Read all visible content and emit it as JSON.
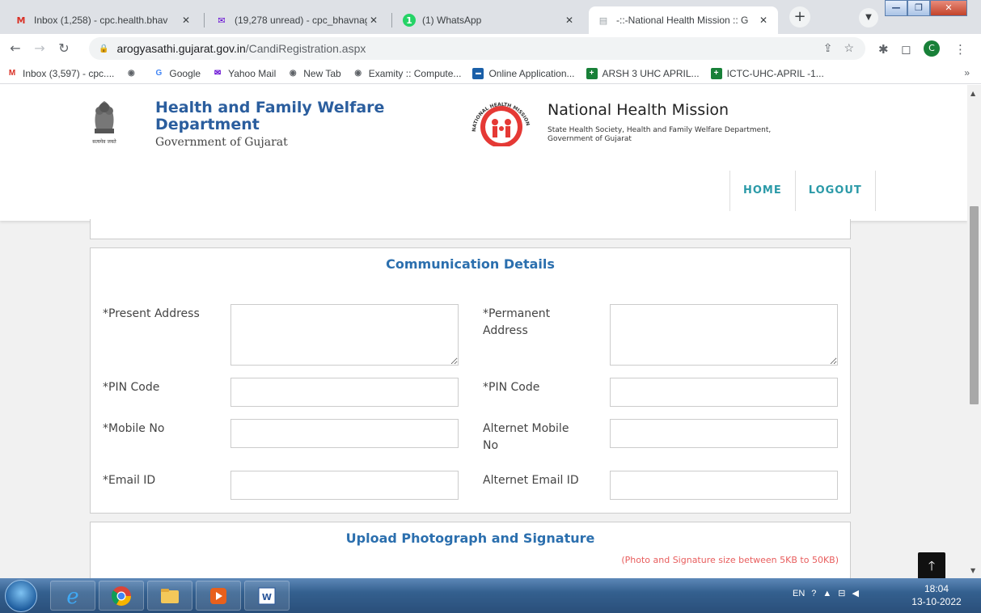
{
  "tabs": [
    {
      "title": "Inbox (1,258) - cpc.health.bhav",
      "icon": "gmail-icon"
    },
    {
      "title": "(19,278 unread) - cpc_bhavnag",
      "icon": "yahoo-mail-icon"
    },
    {
      "title": "(1) WhatsApp",
      "icon": "whatsapp-icon"
    },
    {
      "title": "-::-National Health Mission :: G",
      "icon": "page-icon",
      "active": true
    }
  ],
  "address": {
    "host": "arogyasathi.gujarat.gov.in",
    "path": "/CandiRegistration.aspx"
  },
  "profile_initial": "C",
  "bookmarks": [
    {
      "label": "Inbox (3,597) - cpc....",
      "icon": "gmail-icon"
    },
    {
      "label": "",
      "icon": "globe-icon"
    },
    {
      "label": "Google",
      "icon": "google-icon"
    },
    {
      "label": "Yahoo Mail",
      "icon": "yahoo-mail-icon"
    },
    {
      "label": "New Tab",
      "icon": "globe-icon"
    },
    {
      "label": "Examity :: Compute...",
      "icon": "globe-icon"
    },
    {
      "label": "Online Application...",
      "icon": "form-icon"
    },
    {
      "label": "ARSH 3 UHC APRIL...",
      "icon": "sheets-icon"
    },
    {
      "label": "ICTC-UHC-APRIL -1...",
      "icon": "sheets-icon"
    }
  ],
  "bookmarks_more": "»",
  "site": {
    "dept_title_line1": "Health and Family Welfare",
    "dept_title_line2": "Department",
    "dept_subtitle": "Government of Gujarat",
    "emblem_motto": "सत्यमेव जयते",
    "nhm_title": "National Health Mission",
    "nhm_sub_line1": "State Health Society, Health and Family Welfare Department,",
    "nhm_sub_line2": "Government of Gujarat",
    "nhm_logo_text": "NATIONAL HEALTH MISSION",
    "nav": [
      "HOME",
      "LOGOUT"
    ]
  },
  "communication": {
    "title": "Communication Details",
    "present_address_label": "*Present Address",
    "permanent_address_label_1": "*Permanent",
    "permanent_address_label_2": "Address",
    "pin_label_left": "*PIN Code",
    "pin_label_right": "*PIN Code",
    "mobile_label": "*Mobile No",
    "alt_mobile_label_1": "Alternet Mobile",
    "alt_mobile_label_2": "No",
    "email_label": "*Email ID",
    "alt_email_label": "Alternet Email ID",
    "values": {
      "present_address": "",
      "permanent_address": "",
      "pin_left": "",
      "pin_right": "",
      "mobile": "",
      "alt_mobile": "",
      "email": "",
      "alt_email": ""
    }
  },
  "upload": {
    "title": "Upload Photograph and Signature",
    "note": "(Photo and Signature size between 5KB to 50KB)"
  },
  "taskbar": {
    "apps": [
      "ie-icon",
      "chrome-icon",
      "explorer-icon",
      "media-icon",
      "word-icon"
    ],
    "language": "EN",
    "time": "18:04",
    "date": "13-10-2022"
  },
  "colors": {
    "accent": "#2b6fae",
    "nav_link": "#2b9aa8",
    "note": "#e85d5d",
    "dept_title": "#2b5e9e"
  }
}
